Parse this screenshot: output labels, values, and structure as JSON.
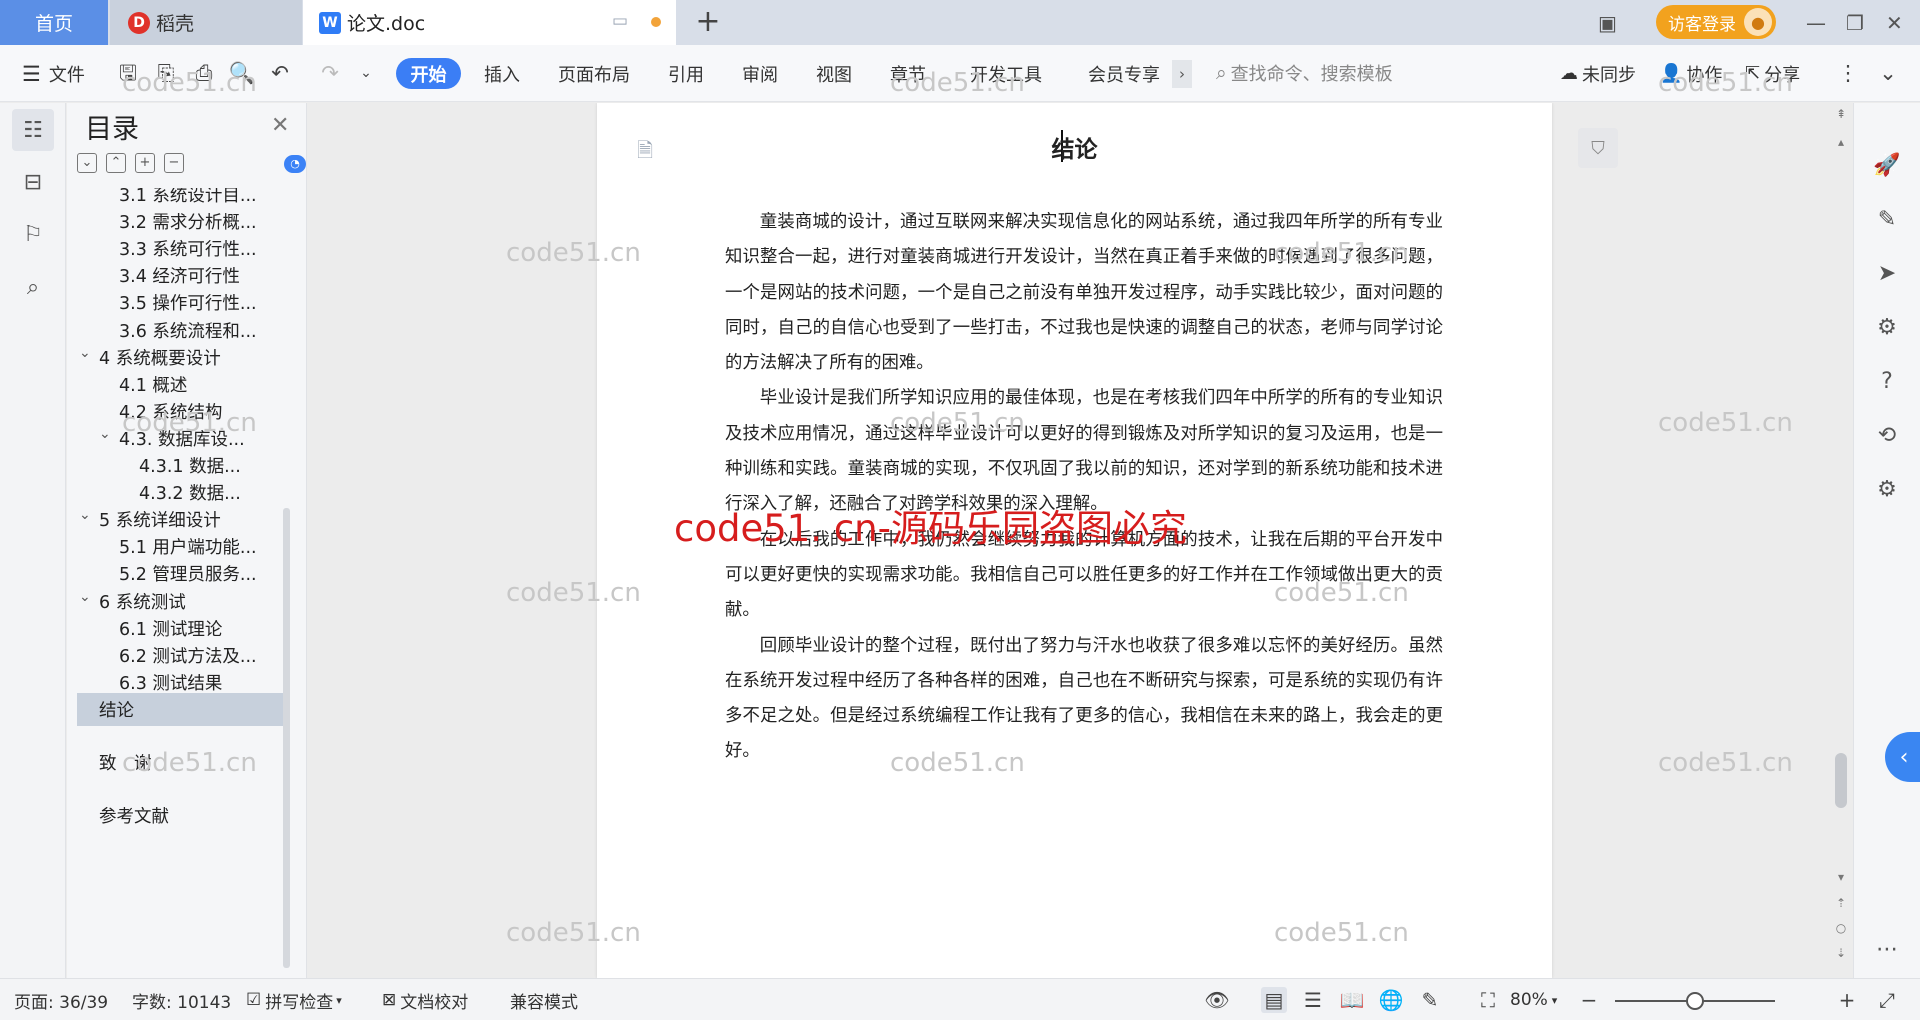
{
  "tabs": {
    "home": "首页",
    "daoke": "稻壳",
    "doc": "论文.doc",
    "login": "访客登录"
  },
  "menu": {
    "file": "文件",
    "start": "开始",
    "items": [
      "插入",
      "页面布局",
      "引用",
      "审阅",
      "视图",
      "章节",
      "开发工具",
      "会员专享"
    ],
    "search_placeholder": "查找命令、搜索模板",
    "sync": "未同步",
    "collab": "协作",
    "share": "分享"
  },
  "toc": {
    "title": "目录",
    "items": [
      {
        "label": "3.1 系统设计目...",
        "level": 2
      },
      {
        "label": "3.2 需求分析概...",
        "level": 2
      },
      {
        "label": "3.3  系统可行性...",
        "level": 2
      },
      {
        "label": "3.4 经济可行性",
        "level": 2
      },
      {
        "label": "3.5 操作可行性...",
        "level": 2
      },
      {
        "label": "3.6 系统流程和...",
        "level": 2
      },
      {
        "label": "4 系统概要设计",
        "level": 1
      },
      {
        "label": "4.1  概述",
        "level": 2
      },
      {
        "label": "4.2  系统结构",
        "level": 2
      },
      {
        "label": "4.3.  数据库设...",
        "level": 2
      },
      {
        "label": "4.3.1  数据...",
        "level": 3
      },
      {
        "label": "4.3.2  数据...",
        "level": 3
      },
      {
        "label": "5 系统详细设计",
        "level": 1
      },
      {
        "label": "5.1 用户端功能...",
        "level": 2
      },
      {
        "label": "5.2 管理员服务...",
        "level": 2
      },
      {
        "label": "6  系统测试",
        "level": 1
      },
      {
        "label": "6.1  测试理论",
        "level": 2
      },
      {
        "label": "6.2  测试方法及...",
        "level": 2
      },
      {
        "label": "6.3  测试结果",
        "level": 2
      },
      {
        "label": "结论",
        "level": 1
      },
      {
        "label": "致　谢",
        "level": 1
      },
      {
        "label": "参考文献",
        "level": 1
      }
    ]
  },
  "document": {
    "title": "结论",
    "paragraphs": [
      "童装商城的设计，通过互联网来解决实现信息化的网站系统，通过我四年所学的所有专业知识整合一起，进行对童装商城进行开发设计，当然在真正着手来做的时候遇到了很多问题，一个是网站的技术问题，一个是自己之前没有单独开发过程序，动手实践比较少，面对问题的同时，自己的自信心也受到了一些打击，不过我也是快速的调整自己的状态，老师与同学讨论的方法解决了所有的困难。",
      "毕业设计是我们所学知识应用的最佳体现，也是在考核我们四年中所学的所有的专业知识及技术应用情况，通过这样毕业设计可以更好的得到锻炼及对所学知识的复习及运用，也是一种训练和实践。童装商城的实现，不仅巩固了我以前的知识，还对学到的新系统功能和技术进行深入了解，还融合了对跨学科效果的深入理解。",
      "在以后我的工作中，我仍然会继续努力我的计算机方面的技术，让我在后期的平台开发中可以更好更快的实现需求功能。我相信自己可以胜任更多的好工作并在工作领域做出更大的贡献。",
      "回顾毕业设计的整个过程，既付出了努力与汗水也收获了很多难以忘怀的美好经历。虽然在系统开发过程中经历了各种各样的困难，自己也在不断研究与探索，可是系统的实现仍有许多不足之处。但是经过系统编程工作让我有了更多的信心，我相信在未来的路上，我会走的更好。"
    ]
  },
  "watermark": {
    "small": "code51.cn",
    "big": "code51. cn-源码乐园盗图必究"
  },
  "status": {
    "page": "页面: 36/39",
    "words": "字数: 10143",
    "spell": "拼写检查",
    "proof": "文档校对",
    "compat": "兼容模式",
    "zoom": "80%",
    "zoom_level": 0.5
  },
  "colors": {
    "accent": "#3b7ef5",
    "login": "#f2a21e",
    "watermark_big": "#d61d1d"
  }
}
